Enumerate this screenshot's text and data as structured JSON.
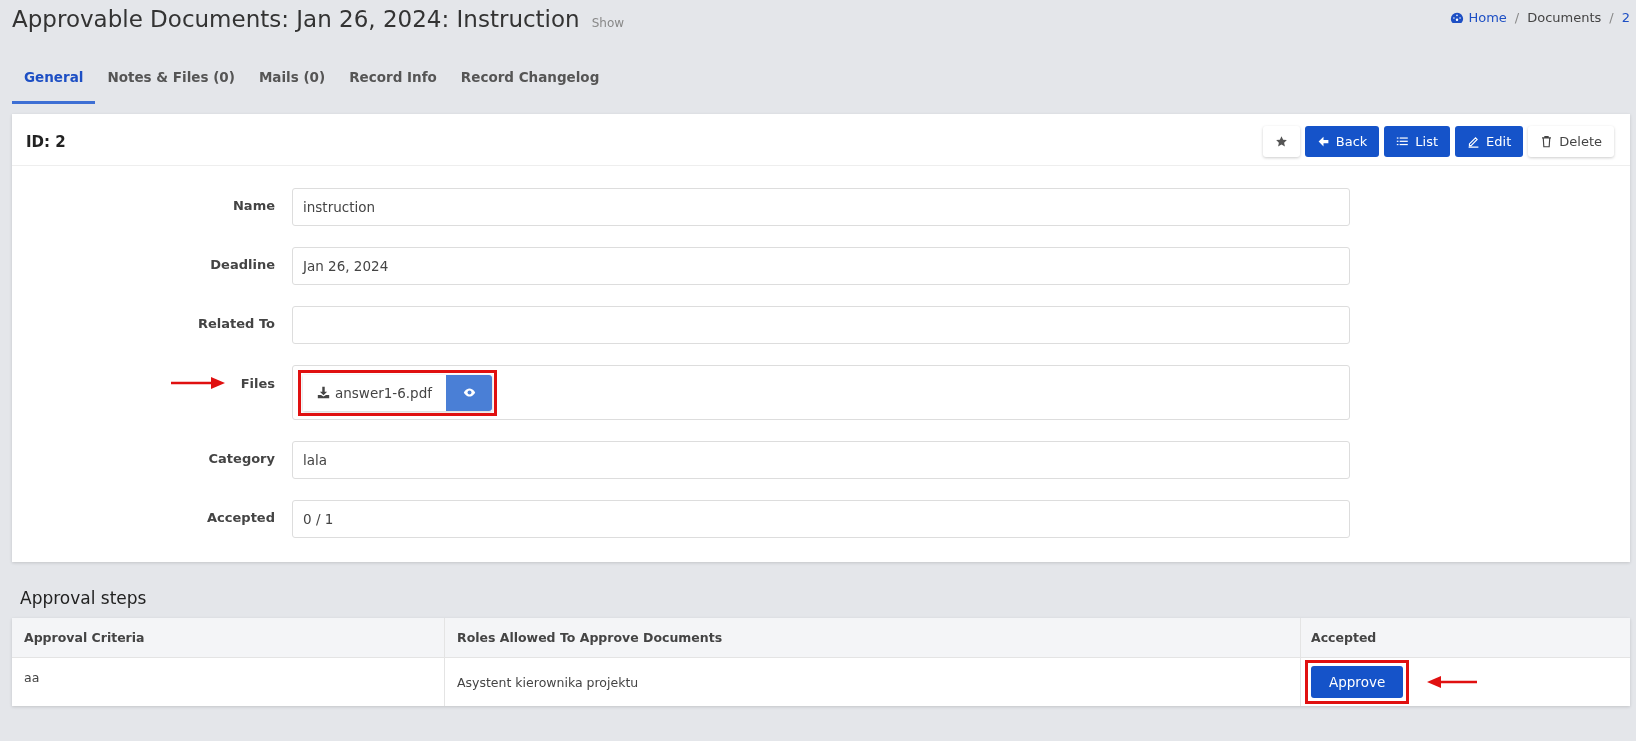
{
  "page": {
    "title": "Approvable Documents: Jan 26, 2024: Instruction",
    "subtitle": "Show"
  },
  "breadcrumb": {
    "separator": "/",
    "items": [
      "Home",
      "Documents",
      "2"
    ]
  },
  "tabs": [
    {
      "label": "General",
      "selected": true
    },
    {
      "label": "Notes & Files (0)",
      "selected": false
    },
    {
      "label": "Mails (0)",
      "selected": false
    },
    {
      "label": "Record Info",
      "selected": false
    },
    {
      "label": "Record Changelog",
      "selected": false
    }
  ],
  "card": {
    "title": "ID: 2",
    "actions": [
      {
        "kind": "star"
      },
      {
        "kind": "back",
        "label": "Back"
      },
      {
        "kind": "list",
        "label": "List"
      },
      {
        "kind": "edit",
        "label": "Edit"
      },
      {
        "kind": "delete",
        "label": "Delete"
      }
    ]
  },
  "fields": [
    {
      "kind": "text",
      "label": "Name",
      "value": "instruction"
    },
    {
      "kind": "text",
      "label": "Deadline",
      "value": "Jan 26, 2024"
    },
    {
      "kind": "text",
      "label": "Related To"
    },
    {
      "kind": "files",
      "label": "Files",
      "file": "answer1-6.pdf"
    },
    {
      "kind": "text",
      "label": "Category",
      "value": "lala"
    },
    {
      "kind": "text",
      "label": "Accepted",
      "value": "0 / 1"
    }
  ],
  "approval": {
    "title": "Approval steps",
    "columns": [
      "Approval Criteria",
      "Roles Allowed To Approve Documents",
      "Accepted"
    ],
    "rows": [
      {
        "criteria": "aa",
        "roles": "Asystent kierownika projektu",
        "action": "Approve"
      }
    ]
  }
}
